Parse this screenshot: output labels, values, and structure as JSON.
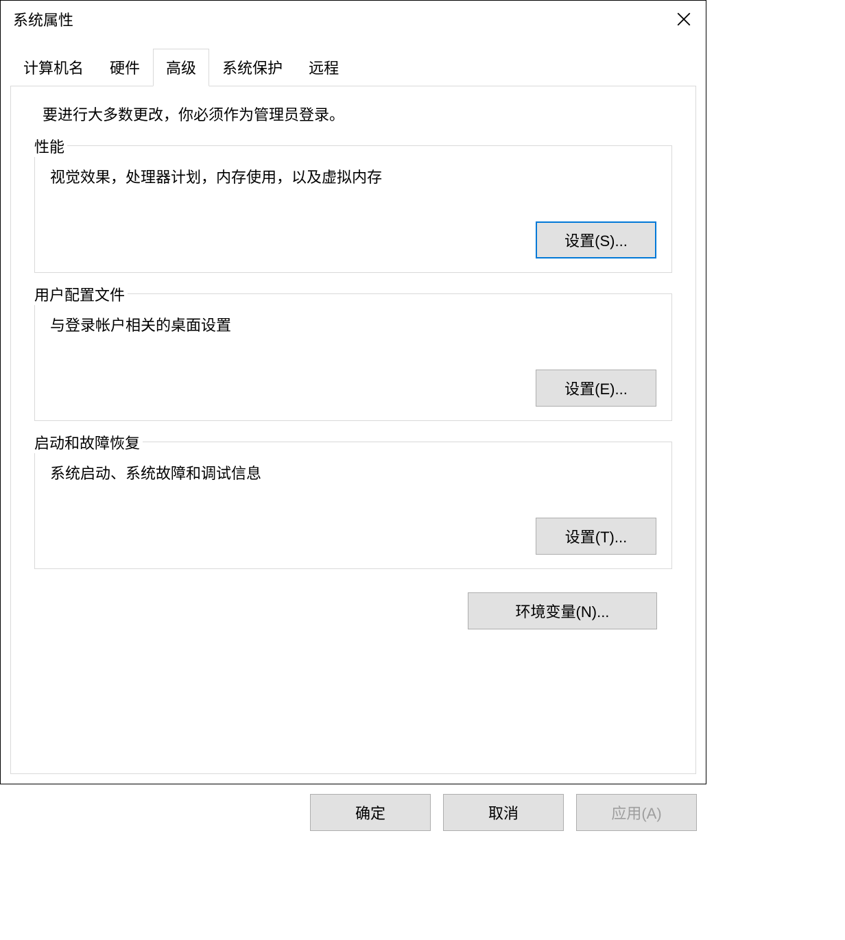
{
  "title": "系统属性",
  "tabs": [
    {
      "label": "计算机名",
      "active": false
    },
    {
      "label": "硬件",
      "active": false
    },
    {
      "label": "高级",
      "active": true
    },
    {
      "label": "系统保护",
      "active": false
    },
    {
      "label": "远程",
      "active": false
    }
  ],
  "admin_note": "要进行大多数更改，你必须作为管理员登录。",
  "groups": {
    "performance": {
      "title": "性能",
      "desc": "视觉效果，处理器计划，内存使用，以及虚拟内存",
      "button": "设置(S)..."
    },
    "user_profiles": {
      "title": "用户配置文件",
      "desc": "与登录帐户相关的桌面设置",
      "button": "设置(E)..."
    },
    "startup_recovery": {
      "title": "启动和故障恢复",
      "desc": "系统启动、系统故障和调试信息",
      "button": "设置(T)..."
    }
  },
  "env_button": "环境变量(N)...",
  "bottom": {
    "ok": "确定",
    "cancel": "取消",
    "apply": "应用(A)"
  }
}
